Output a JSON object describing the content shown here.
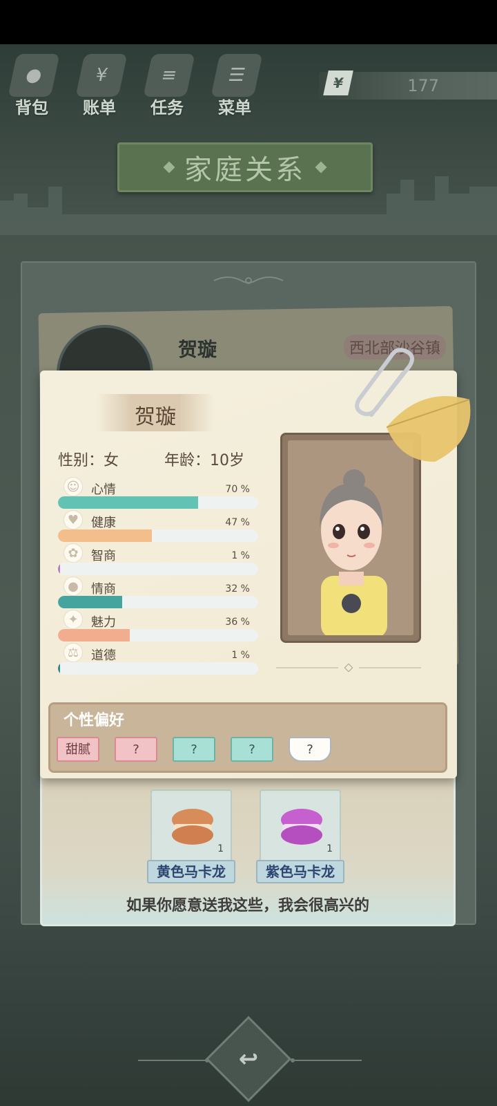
{
  "top_menu": [
    {
      "label": "背包",
      "icon": "bag-icon"
    },
    {
      "label": "账单",
      "icon": "bill-icon"
    },
    {
      "label": "任务",
      "icon": "task-icon"
    },
    {
      "label": "菜单",
      "icon": "menu-icon"
    }
  ],
  "currency": {
    "symbol": "¥",
    "value": "177"
  },
  "page_title": "家庭关系",
  "back_card": {
    "name": "贺璇",
    "location": "西北部沙谷镇"
  },
  "profile": {
    "name": "贺璇",
    "gender": "性别：女",
    "age": "年龄：10岁",
    "stats": [
      {
        "label": "心情",
        "pct_text": "70 %",
        "value": 70,
        "icon": "smile-icon",
        "color": "#62c2b4"
      },
      {
        "label": "健康",
        "pct_text": "47 %",
        "value": 47,
        "icon": "heart-icon",
        "color": "#f3bd8c"
      },
      {
        "label": "智商",
        "pct_text": "1 %",
        "value": 1,
        "icon": "brain-icon",
        "color": "#b27fc7"
      },
      {
        "label": "情商",
        "pct_text": "32 %",
        "value": 32,
        "icon": "apple-icon",
        "color": "#45a49d"
      },
      {
        "label": "魅力",
        "pct_text": "36 %",
        "value": 36,
        "icon": "sparkle-icon",
        "color": "#f1ad8e"
      },
      {
        "label": "道德",
        "pct_text": "1 %",
        "value": 1,
        "icon": "scales-icon",
        "color": "#2f8a8f"
      }
    ]
  },
  "preferences": {
    "title": "个性偏好",
    "tags": [
      {
        "label": "甜腻",
        "style": "pink"
      },
      {
        "label": "?",
        "style": "pink"
      },
      {
        "label": "?",
        "style": "teal"
      },
      {
        "label": "?",
        "style": "teal"
      },
      {
        "label": "?",
        "style": "cup"
      }
    ]
  },
  "gifts": [
    {
      "label": "黄色马卡龙",
      "count": "1",
      "color": "#d88c5a"
    },
    {
      "label": "紫色马卡龙",
      "count": "1",
      "color": "#c660cf"
    }
  ],
  "gift_message": "如果你愿意送我这些，我会很高兴的",
  "back_button_icon": "return-icon"
}
